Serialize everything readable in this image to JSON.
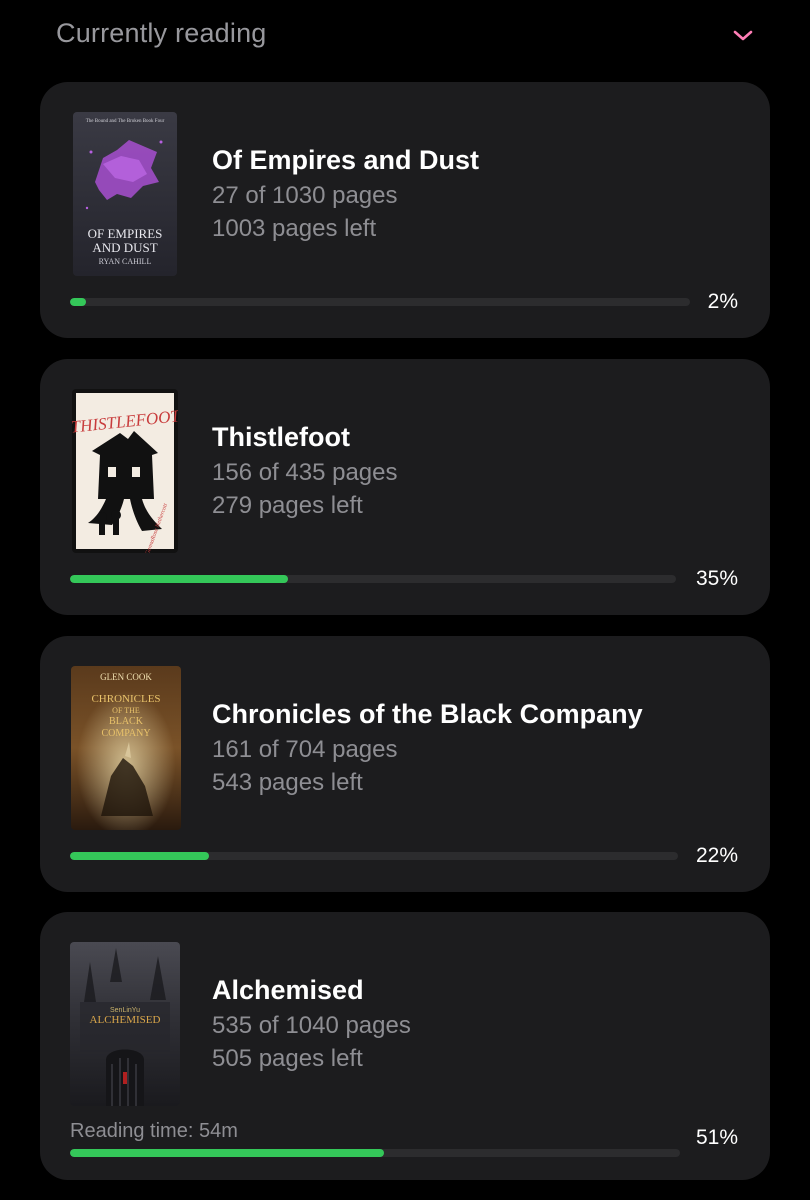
{
  "section": {
    "title": "Currently reading"
  },
  "colors": {
    "accent": "#ff7eb6",
    "progress": "#34c759",
    "card": "#1c1c1e"
  },
  "icons": {
    "collapse": "chevron-down-icon"
  },
  "books": [
    {
      "title": "Of Empires and Dust",
      "pages": "27 of 1030 pages",
      "left": "1003 pages left",
      "percent_label": "2%",
      "progress": 0.026,
      "cover": {
        "series": "The Bound and The Broken Book Four",
        "title_line1": "OF EMPIRES",
        "title_line2": "AND DUST",
        "author": "RYAN CAHILL"
      }
    },
    {
      "title": "Thistlefoot",
      "pages": "156 of 435 pages",
      "left": "279 pages left",
      "percent_label": "35%",
      "progress": 0.359,
      "cover": {
        "title": "THISTLEFOOT"
      }
    },
    {
      "title": "Chronicles of the Black Company",
      "pages": "161 of 704 pages",
      "left": "543 pages left",
      "percent_label": "22%",
      "progress": 0.229,
      "cover": {
        "author": "GLEN COOK",
        "title_line1": "CHRONICLES",
        "title_line2": "OF THE",
        "title_line3": "BLACK",
        "title_line4": "COMPANY"
      }
    },
    {
      "title": "Alchemised",
      "pages": "535 of 1040 pages",
      "left": "505 pages left",
      "percent_label": "51%",
      "progress": 0.514,
      "reading_time": "Reading time: 54m",
      "cover": {
        "author": "SenLinYu",
        "title": "ALCHEMISED"
      }
    }
  ]
}
